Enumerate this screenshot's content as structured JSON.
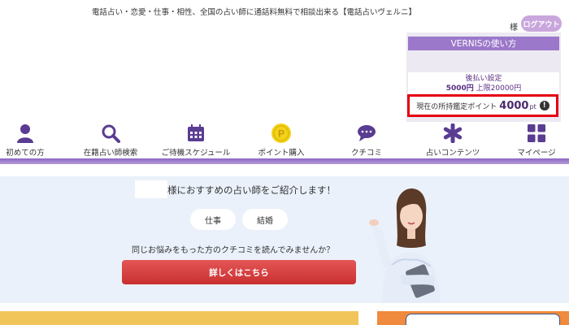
{
  "header": {
    "tagline": "電話占い・恋愛・仕事・相性、全国の占い師に通話料無料で相談出来る【電話占いヴェルニ】",
    "user_suffix": "様",
    "logout_label": "ログアウト"
  },
  "account_panel": {
    "title": "VERNISの使い方",
    "payment_label": "後払い設定",
    "payment_amount": "5000円",
    "payment_limit": "上限20000円",
    "points_label": "現在の所持鑑定ポイント",
    "points_value": "4000",
    "points_unit": "pt",
    "info_icon": "!"
  },
  "nav": {
    "items": [
      {
        "label": "初めての方",
        "icon": "person-icon"
      },
      {
        "label": "在籍占い師検索",
        "icon": "search-icon"
      },
      {
        "label": "ご待機スケジュール",
        "icon": "calendar-icon"
      },
      {
        "label": "ポイント購入",
        "icon": "coin-icon",
        "coin_letter": "P"
      },
      {
        "label": "クチコミ",
        "icon": "speech-bubble-icon"
      },
      {
        "label": "占いコンテンツ",
        "icon": "asterisk-icon"
      },
      {
        "label": "マイページ",
        "icon": "grid-icon"
      }
    ]
  },
  "recommend": {
    "title": "様におすすめの占い師をご紹介します！",
    "tags": [
      "仕事",
      "結婚"
    ],
    "question": "同じお悩みをもった方のクチコミを読んでみませんか？",
    "cta_label": "詳しくはこちら"
  },
  "colors": {
    "accent_purple": "#9b78c9",
    "logout_bg": "#c9a6dc",
    "highlight_red": "#e50012",
    "cta_red": "#d43c3c",
    "section_bg": "#eaf1fa"
  }
}
